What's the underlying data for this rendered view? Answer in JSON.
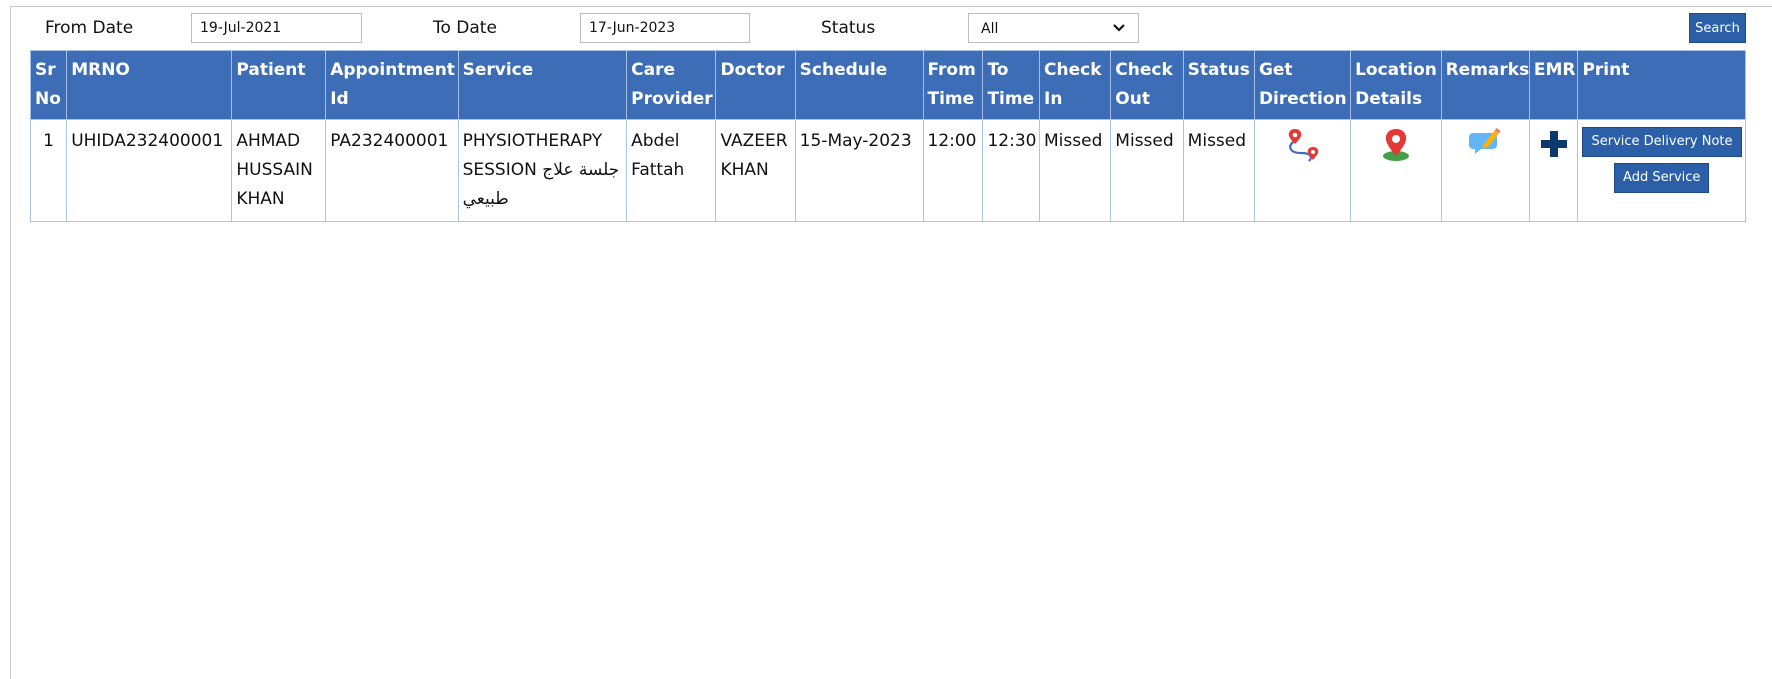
{
  "filters": {
    "from_date_label": "From Date",
    "from_date_value": "19-Jul-2021",
    "to_date_label": "To Date",
    "to_date_value": "17-Jun-2023",
    "status_label": "Status",
    "status_value": "All",
    "search_label": "Search"
  },
  "table": {
    "headers": {
      "sr_no": "Sr No",
      "mrno": "MRNO",
      "patient": "Patient",
      "appointment_id": "Appointment Id",
      "service": "Service",
      "care_provider": "Care Provider",
      "doctor": "Doctor",
      "schedule": "Schedule",
      "from_time": "From Time",
      "to_time": "To Time",
      "check_in": "Check In",
      "check_out": "Check Out",
      "status": "Status",
      "get_direction": "Get Direction",
      "location_details": "Location Details",
      "remarks": "Remarks",
      "emr": "EMR",
      "print": "Print"
    },
    "rows": [
      {
        "sr_no": "1",
        "mrno": "UHIDA232400001",
        "patient": "AHMAD HUSSAIN KHAN",
        "appointment_id": "PA232400001",
        "service": "PHYSIOTHERAPY SESSION جلسة علاج طبيعي",
        "care_provider": "Abdel Fattah",
        "doctor": "VAZEER KHAN",
        "schedule": "15-May-2023",
        "from_time": "12:00",
        "to_time": "12:30",
        "check_in": "Missed",
        "check_out": "Missed",
        "status": "Missed",
        "icons": {
          "get_direction": "route-pins-icon",
          "location_details": "map-pin-icon",
          "remarks": "chat-edit-icon",
          "emr": "plus-icon"
        },
        "print_buttons": {
          "service_delivery_note": "Service Delivery Note",
          "add_service": "Add Service"
        }
      }
    ]
  },
  "colors": {
    "header_bg": "#3d6db6",
    "button_bg": "#2b5fa8",
    "link": "#2424e8",
    "pin_red": "#e53935",
    "emr_navy": "#0d3a6e"
  }
}
